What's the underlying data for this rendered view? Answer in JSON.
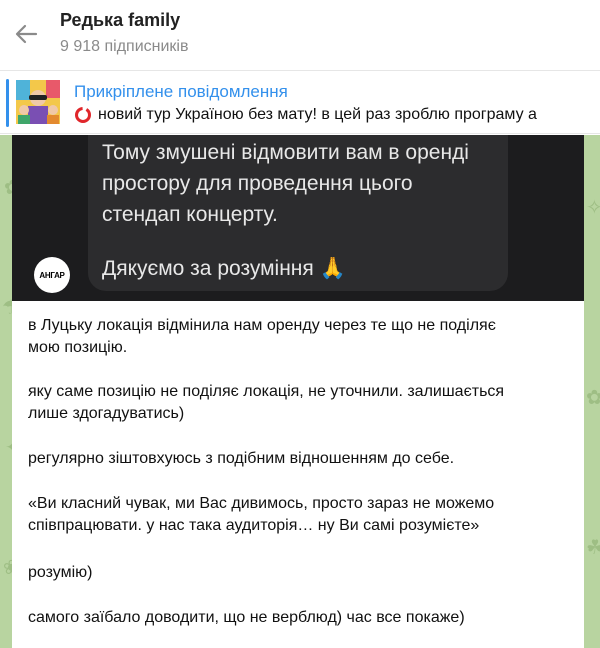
{
  "channel": {
    "title": "Редька family",
    "subscribers": "9 918 підписників"
  },
  "pinned": {
    "label": "Прикріплене повідомлення",
    "text": "новий тур Україною без мату!  в цей раз зроблю програму а"
  },
  "media": {
    "lines": [
      "Тому змушені відмовити вам в оренді",
      "простору для проведення цього",
      "стендап концерту.",
      "Дякуємо за розуміння 🙏"
    ],
    "logo_text": "АНГАР"
  },
  "message": {
    "lines": [
      "в Луцьку локація відмінила нам оренду через те що не поділяє",
      "мою позицію.",
      "яку саме позицію не поділяє локація, не уточнили. залишається",
      "лише здогадуватись)",
      "регулярно зіштовхуюсь з подібним відношенням до себе.",
      "«Ви класний чувак, ми Вас дивимось, просто зараз не можемо",
      "співпрацювати. у нас така аудиторія… ну Ви самі розумієте»",
      "розумію)",
      "самого заїбало доводити, що не верблюд) час все покаже)"
    ]
  },
  "colors": {
    "accent": "#3390ec",
    "chat_background": "#b8d4a0",
    "media_background": "#1c1c1e"
  },
  "icons": {
    "back": "arrow-left-icon",
    "pinned_status": "red-circle-icon"
  }
}
